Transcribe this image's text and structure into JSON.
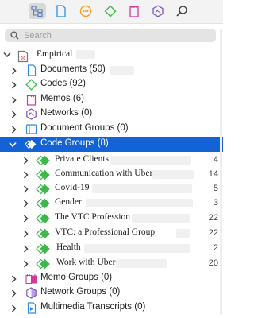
{
  "toolbar": {
    "buttons": [
      {
        "name": "project-explorer-icon",
        "color": "#5b7fb5",
        "active": true
      },
      {
        "name": "document-icon",
        "color": "#2f8fd8"
      },
      {
        "name": "quotation-icon",
        "color": "#f0a020"
      },
      {
        "name": "code-icon",
        "color": "#3db84a"
      },
      {
        "name": "memo-icon",
        "color": "#d23a9a"
      },
      {
        "name": "network-icon",
        "color": "#7a55c0"
      },
      {
        "name": "search-icon",
        "color": "#333333"
      }
    ]
  },
  "search": {
    "placeholder": "Search"
  },
  "tree": {
    "root": {
      "label": "Empirical"
    },
    "items": [
      {
        "label": "Documents",
        "count": "(50)",
        "icon": "document-icon",
        "color": "#2f8fd8"
      },
      {
        "label": "Codes",
        "count": "(92)",
        "icon": "code-icon",
        "color": "#3db84a"
      },
      {
        "label": "Memos",
        "count": "(6)",
        "icon": "memo-icon",
        "color": "#d23a9a"
      },
      {
        "label": "Networks",
        "count": "(0)",
        "icon": "network-icon",
        "color": "#7a55c0"
      },
      {
        "label": "Document Groups",
        "count": "(0)",
        "icon": "document-group-icon",
        "color": "#2f8fd8"
      },
      {
        "label": "Code Groups",
        "count": "(8)",
        "icon": "code-group-icon",
        "color": "#3db84a",
        "selected": true,
        "expanded": true
      }
    ],
    "code_groups": [
      {
        "label": "Private Clients",
        "count": "4"
      },
      {
        "label": "Communication with Uber",
        "count": "14"
      },
      {
        "label": "Covid-19",
        "count": "5"
      },
      {
        "label": "Gender",
        "count": "3"
      },
      {
        "label": "The VTC Profession",
        "count": "22"
      },
      {
        "label": "VTC: a Professional Group",
        "count": "22"
      },
      {
        "label": "Health",
        "count": "2"
      },
      {
        "label": "Work with Uber",
        "count": "20"
      }
    ],
    "bottom_items": [
      {
        "label": "Memo Groups",
        "count": "(0)",
        "icon": "memo-group-icon",
        "color": "#d23a9a"
      },
      {
        "label": "Network Groups",
        "count": "(0)",
        "icon": "network-group-icon",
        "color": "#7a55c0"
      },
      {
        "label": "Multimedia Transcripts",
        "count": "(0)",
        "icon": "multimedia-transcript-icon",
        "color": "#2f8fd8"
      }
    ]
  }
}
